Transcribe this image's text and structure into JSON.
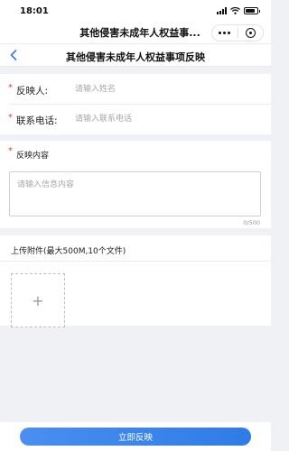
{
  "status_bar": {
    "time": "18:01"
  },
  "wechat_bar": {
    "title": "其他侵害未成年人权益事..."
  },
  "header": {
    "title": "其他侵害未成年人权益事项反映"
  },
  "form": {
    "reporter": {
      "required_mark": "*",
      "label": "反映人:",
      "placeholder": "请输入姓名"
    },
    "phone": {
      "required_mark": "*",
      "label": "联系电话:",
      "placeholder": "请输入联系电话"
    },
    "content": {
      "required_mark": "*",
      "label": "反映内容",
      "placeholder": "请输入信息内容",
      "counter": "0/500"
    },
    "attachment": {
      "label": "上传附件(最大500M,10个文件)",
      "add_symbol": "+"
    }
  },
  "submit": {
    "label": "立即反映"
  },
  "colors": {
    "accent": "#3784ec",
    "required": "#e23b3b",
    "background": "#f0f1f4"
  },
  "icons": [
    "signal-icon",
    "wifi-icon",
    "battery-icon",
    "more-icon",
    "close-mini-program-icon",
    "back-icon",
    "plus-icon"
  ]
}
